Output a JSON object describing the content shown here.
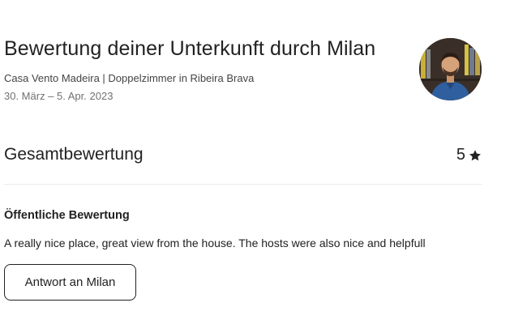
{
  "header": {
    "title": "Bewertung deiner Unterkunft durch Milan",
    "listing": "Casa Vento Madeira | Doppelzimmer in Ribeira Brava",
    "dates": "30. März – 5. Apr. 2023"
  },
  "overall": {
    "label": "Gesamtbewertung",
    "value": "5",
    "icon": "star-icon"
  },
  "public_review": {
    "heading": "Öffentliche Bewertung",
    "text": "A really nice place, great view from the house. The hosts were also nice and helpfull"
  },
  "actions": {
    "reply_label": "Antwort an Milan"
  },
  "colors": {
    "text_primary": "#222222",
    "text_secondary": "#717171",
    "divider": "#ebebeb",
    "avatar_shirt": "#2f5f9e"
  }
}
